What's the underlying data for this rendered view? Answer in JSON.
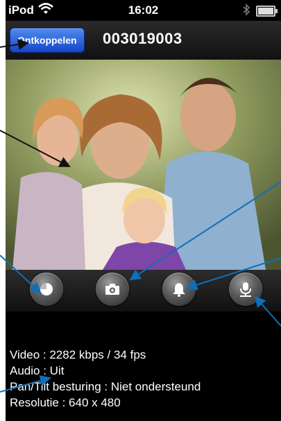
{
  "statusbar": {
    "carrier": "iPod",
    "time": "16:02"
  },
  "navbar": {
    "disconnect_label": "Ontkoppelen",
    "camera_id": "003019003"
  },
  "video": {
    "content": "family-photo"
  },
  "controls": [
    {
      "icon": "record-icon"
    },
    {
      "icon": "snapshot-camera-icon"
    },
    {
      "icon": "alarm-bell-icon"
    },
    {
      "icon": "microphone-icon"
    }
  ],
  "info": {
    "video": "Video : 2282 kbps / 34 fps",
    "audio": "Audio : Uit",
    "pantilt": "Pan/Tilt besturing : Niet ondersteund",
    "resolution": "Resolutie : 640 x 480"
  },
  "colors": {
    "accent": "#1f5fd6",
    "arrow": "#0f6fb8",
    "background": "#000000"
  }
}
